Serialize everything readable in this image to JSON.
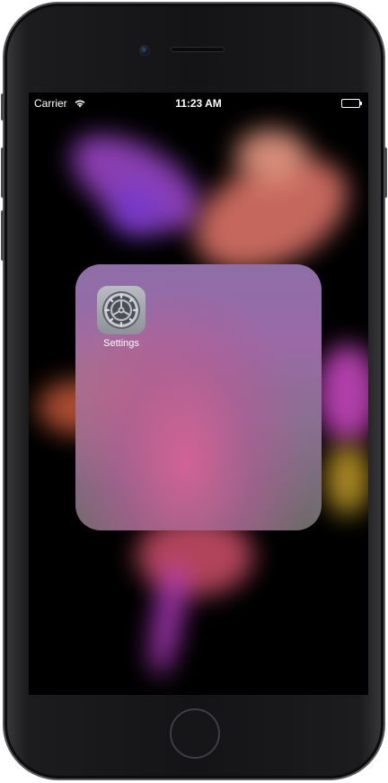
{
  "status_bar": {
    "carrier": "Carrier",
    "time": "11:23 AM",
    "wifi_icon": "wifi-icon",
    "battery_icon": "battery-icon",
    "battery_level": 1.0
  },
  "folder": {
    "apps": [
      {
        "label": "Settings",
        "icon": "gear-icon"
      }
    ]
  },
  "colors": {
    "status_text": "#ffffff",
    "screen_background": "#000000",
    "device_body": "#1c1c1e"
  }
}
